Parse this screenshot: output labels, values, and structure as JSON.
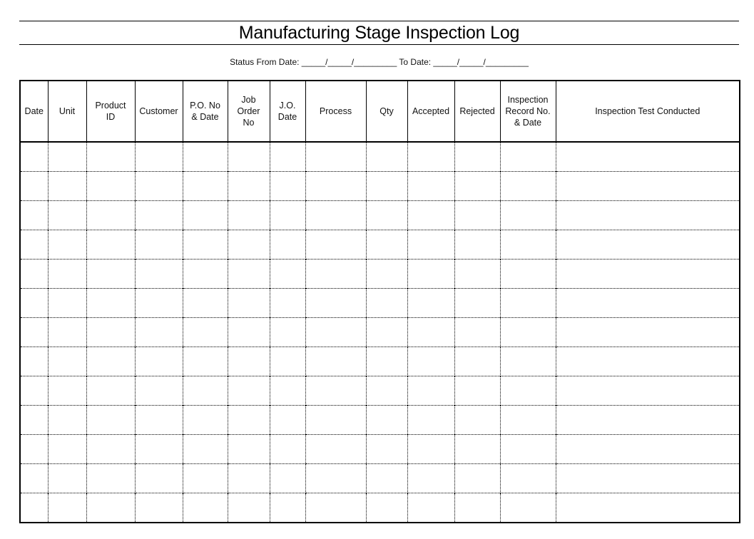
{
  "document": {
    "title": "Manufacturing Stage Inspection Log",
    "status_line": {
      "from_label": "Status From Date: ",
      "from_blank": "_____/_____/_________",
      "to_label": " To Date: ",
      "to_blank": "_____/_____/_________"
    }
  },
  "table": {
    "columns": [
      {
        "key": "date",
        "label": "Date"
      },
      {
        "key": "unit",
        "label": "Unit"
      },
      {
        "key": "product_id",
        "label": "Product\nID"
      },
      {
        "key": "customer",
        "label": "Customer"
      },
      {
        "key": "po_no_date",
        "label": "P.O. No\n& Date"
      },
      {
        "key": "job_order_no",
        "label": "Job\nOrder\nNo"
      },
      {
        "key": "jo_date",
        "label": "J.O.\nDate"
      },
      {
        "key": "process",
        "label": "Process"
      },
      {
        "key": "qty",
        "label": "Qty"
      },
      {
        "key": "accepted",
        "label": "Accepted"
      },
      {
        "key": "rejected",
        "label": "Rejected"
      },
      {
        "key": "inspection_record",
        "label": "Inspection\nRecord No.\n& Date"
      },
      {
        "key": "inspection_test",
        "label": "Inspection Test Conducted"
      }
    ],
    "rows": [
      [
        "",
        "",
        "",
        "",
        "",
        "",
        "",
        "",
        "",
        "",
        "",
        "",
        ""
      ],
      [
        "",
        "",
        "",
        "",
        "",
        "",
        "",
        "",
        "",
        "",
        "",
        "",
        ""
      ],
      [
        "",
        "",
        "",
        "",
        "",
        "",
        "",
        "",
        "",
        "",
        "",
        "",
        ""
      ],
      [
        "",
        "",
        "",
        "",
        "",
        "",
        "",
        "",
        "",
        "",
        "",
        "",
        ""
      ],
      [
        "",
        "",
        "",
        "",
        "",
        "",
        "",
        "",
        "",
        "",
        "",
        "",
        ""
      ],
      [
        "",
        "",
        "",
        "",
        "",
        "",
        "",
        "",
        "",
        "",
        "",
        "",
        ""
      ],
      [
        "",
        "",
        "",
        "",
        "",
        "",
        "",
        "",
        "",
        "",
        "",
        "",
        ""
      ],
      [
        "",
        "",
        "",
        "",
        "",
        "",
        "",
        "",
        "",
        "",
        "",
        "",
        ""
      ],
      [
        "",
        "",
        "",
        "",
        "",
        "",
        "",
        "",
        "",
        "",
        "",
        "",
        ""
      ],
      [
        "",
        "",
        "",
        "",
        "",
        "",
        "",
        "",
        "",
        "",
        "",
        "",
        ""
      ],
      [
        "",
        "",
        "",
        "",
        "",
        "",
        "",
        "",
        "",
        "",
        "",
        "",
        ""
      ],
      [
        "",
        "",
        "",
        "",
        "",
        "",
        "",
        "",
        "",
        "",
        "",
        "",
        ""
      ],
      [
        "",
        "",
        "",
        "",
        "",
        "",
        "",
        "",
        "",
        "",
        "",
        "",
        ""
      ]
    ]
  }
}
